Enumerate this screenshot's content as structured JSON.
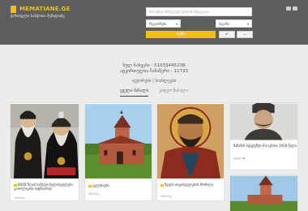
{
  "header": {
    "site_name": "MEMATIANE.GE",
    "site_sub": "ქართველი საბჭოთა მემატიანე",
    "search_placeholder": "მოძებნეთ მასალები დროის მიხედვით",
    "select_left": "რეგიონები",
    "select_right": "საგანი",
    "search_button": "ძებნა",
    "reset_icon": "undo-icon",
    "extra_icon": "minus-icon",
    "top_icons": [
      "mail-icon",
      "user-icon"
    ],
    "accent_color": "#f2c012",
    "bg_color": "#5e5e5e"
  },
  "stats": {
    "total_views_label": "სულ ნახვები",
    "total_views": "51033445238",
    "uploaded_label": "ატვირთულია ჩანაწერი",
    "uploaded": "11733"
  },
  "latest_label": "ავტორები / სიახლეები",
  "tabs": [
    {
      "label": "ყველა მასალა",
      "active": true
    },
    {
      "label": "ვიდეო მასალა",
      "active": false
    }
  ],
  "cards": [
    {
      "text": "8000 წლის სამეფო ხელისუფლები,  კათოლიკოს-პატრიარქი",
      "meta": "ამოსახე",
      "thumb": "patriarchs-photo"
    },
    {
      "text": "ეკლესიები",
      "meta": "ამოსახე",
      "thumb": "church-photo"
    },
    {
      "text": "შეფის თავისუფლების ბრძოლა",
      "meta": "ამოსახე",
      "thumb": "icon-painting"
    },
    {
      "text": "მამამის სტუდენტი 04 ივნისი 1918 წელი",
      "meta": "ვიდეო",
      "thumb": "man-portrait"
    }
  ]
}
